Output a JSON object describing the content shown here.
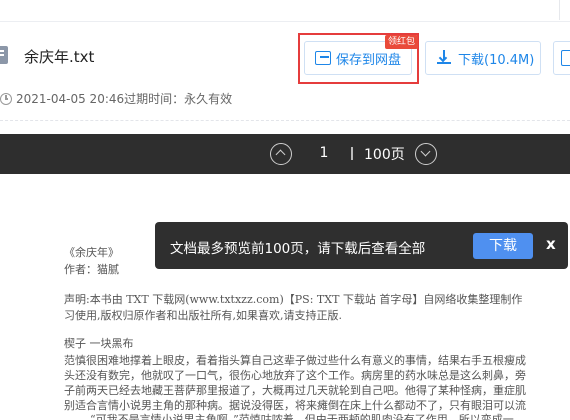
{
  "file": {
    "name": "余庆年.txt",
    "date": "2021-04-05 20:46",
    "expiry_label": "过期时间：",
    "expiry_value": "永久有效"
  },
  "actions": {
    "save_label": "保存到网盘",
    "save_badge": "领红包",
    "download_label": "下载(10.4M)"
  },
  "pager": {
    "current_page": "1",
    "total_pages": "100页"
  },
  "toast": {
    "message": "文档最多预览前100页，请下载后查看全部",
    "download_label": "下载",
    "close_label": "x"
  },
  "document": {
    "lines": [
      "《余庆年》",
      "作者：猫腻",
      "声明:本书由 TXT 下载网(www.txtxzz.com)【PS: TXT 下载站 首字母】自网络收集整理制作",
      "习使用,版权归原作者和出版社所有,如果喜欢,请支持正版.",
      "楔子  一块黑布",
      "范慎很困难地撑着上眼皮，看着指头算自己这辈子做过些什么有意义的事情，结果右手五根瘦成",
      "头还没有数完，他就叹了一口气，很伤心地放弃了这个工作。病房里的药水味总是这么刺鼻，旁",
      "子前两天已经去地藏王菩萨那里报道了，大概再过几天就轮到自己吧。他得了某种怪病，重症肌",
      "别适合言情小说男主角的那种病。据说没得医，将来瘫倒在床上什么都动不了，只有眼泪可以流",
      "“可我不是言情小说男主角啊。”范慎咕哝着，但由于两颊的肌肉没有了作用，所以变成一"
    ]
  },
  "colors": {
    "accent": "#1e86e8",
    "highlight_border": "#e53c3c",
    "badge": "#e94a3a",
    "pager_bg": "#2e2e2e",
    "toast_bg": "#2f2f2f",
    "toast_button": "#4f90f0"
  }
}
